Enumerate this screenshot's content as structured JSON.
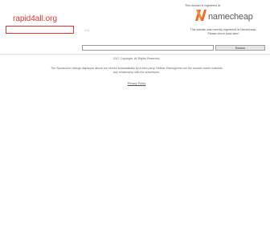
{
  "header": {
    "top_note": "This domain is registered at",
    "site_title": "rapid4all.org",
    "faded_word": "KAL",
    "logo_text": "namecheap",
    "right_note": [
      "This domain was recently registered at Namecheap.",
      "Please check back later!"
    ]
  },
  "search": {
    "input_value": "",
    "button_label": "Search"
  },
  "footer": {
    "copyright": "2017 Copyright. All Rights Reserved.",
    "disclaimer": [
      "The Sponsored Listings displayed above are served automatically by a third party. Neither Parkingcrew nor the domain owner maintain",
      "any relationship with the advertisers."
    ],
    "privacy_link": "Privacy Policy"
  },
  "colors": {
    "title_red": "#e0352b",
    "logo_orange": "#f26a1b"
  }
}
